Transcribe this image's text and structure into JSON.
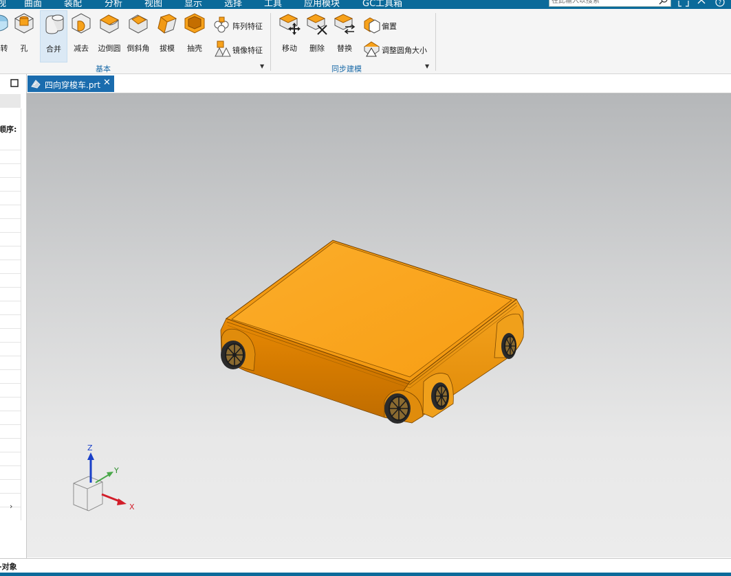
{
  "menubar": {
    "items": [
      "视",
      "曲面",
      "装配",
      "分析",
      "视图",
      "显示",
      "选择",
      "工具",
      "应用模块",
      "GC工具箱"
    ],
    "search_placeholder": "在此输入以搜索"
  },
  "ribbon": {
    "buttons": {
      "rotate": "转",
      "hole": "孔",
      "unite": "合并",
      "subtract": "减去",
      "edge_blend": "边倒圆",
      "chamfer": "倒斜角",
      "draft": "拔模",
      "shell": "抽壳",
      "pattern_feature": "阵列特征",
      "mirror_feature": "镜像特征",
      "move": "移动",
      "delete": "删除",
      "replace": "替换",
      "offset": "偏置",
      "resize_blend": "调整圆角大小"
    },
    "groups": {
      "basic": "基本",
      "sync_modeling": "同步建模"
    }
  },
  "left_panel": {
    "order_label": "顺序:"
  },
  "tabs": {
    "doc_label": "四向穿梭车.prt",
    "close_glyph": "✕"
  },
  "triad": {
    "x": "X",
    "y": "Y",
    "z": "Z"
  },
  "status": {
    "text": "对象"
  },
  "colors": {
    "accent_blue": "#0b6a9a",
    "tab_blue": "#1a6cae",
    "model_orange": "#f7a21b"
  }
}
